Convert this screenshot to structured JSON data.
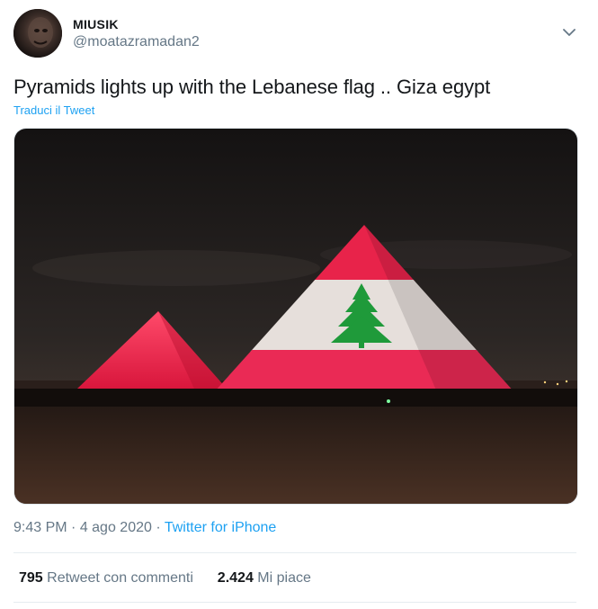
{
  "tweet": {
    "author_name": "MIUSIK",
    "author_handle": "@moatazramadan2",
    "text": "Pyramids lights up with the Lebanese flag .. Giza egypt",
    "translate_label": "Traduci il Tweet",
    "time": "9:43 PM",
    "separator": " · ",
    "date": "4 ago 2020",
    "source": "Twitter for iPhone"
  },
  "stats": {
    "retweets_count": "795",
    "retweets_label": "Retweet con commenti",
    "likes_count": "2.424",
    "likes_label": "Mi piace"
  },
  "icons": {
    "caret": "chevron-down-icon"
  },
  "colors": {
    "link": "#1da1f2",
    "secondary_text": "#657786",
    "flag_red": "#e8234a",
    "flag_white": "#e8e2de",
    "cedar_green": "#1f9a3a"
  }
}
